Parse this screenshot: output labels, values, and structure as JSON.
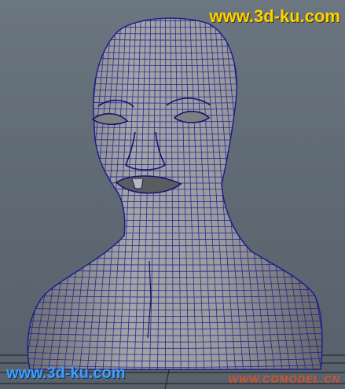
{
  "viewport": {
    "subject": "polygon-head-bust-wireframe",
    "colors": {
      "background_top": "#6b7681",
      "background_bottom": "#57616b",
      "mesh_fill": "#9a9a9c",
      "mesh_shadow": "#6e6f73",
      "wire": "#1e1e8c",
      "ground_grid": "#000000"
    }
  },
  "watermarks": {
    "top_right": "www.3d-ku.com",
    "bottom_left": "www.3d-ku.com",
    "bottom_right": "WWW.CGMODEL.CN"
  }
}
